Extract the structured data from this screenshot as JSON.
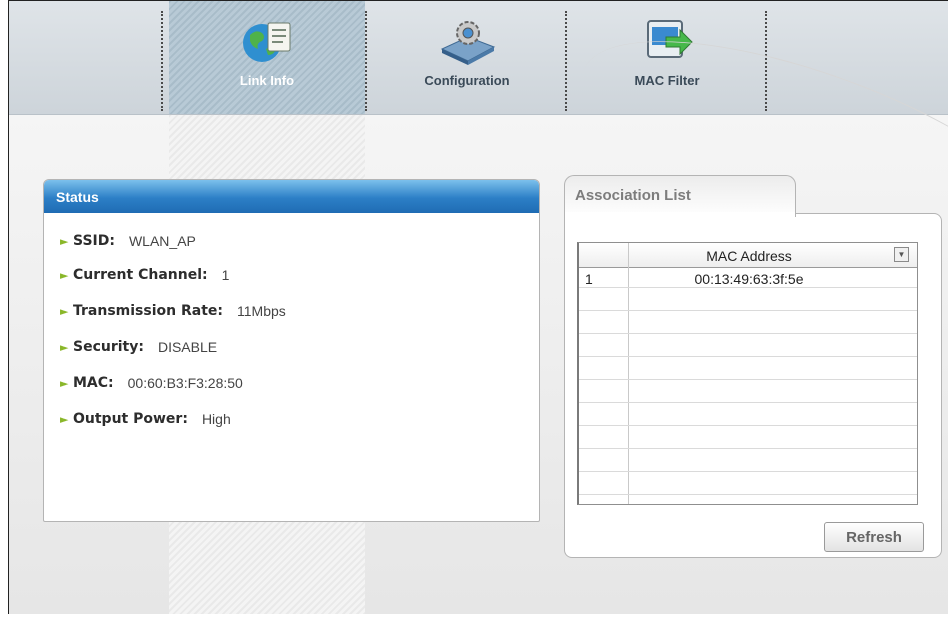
{
  "nav": {
    "tabs": [
      {
        "label": "Link Info",
        "icon": "globe-document-icon",
        "active": true
      },
      {
        "label": "Configuration",
        "icon": "gear-device-icon",
        "active": false
      },
      {
        "label": "MAC Filter",
        "icon": "filter-arrow-icon",
        "active": false
      }
    ]
  },
  "status": {
    "title": "Status",
    "rows": [
      {
        "label": "SSID:",
        "value": "WLAN_AP"
      },
      {
        "label": "Current Channel:",
        "value": "1"
      },
      {
        "label": "Transmission Rate:",
        "value": "11Mbps"
      },
      {
        "label": "Security:",
        "value": "DISABLE"
      },
      {
        "label": "MAC:",
        "value": "00:60:B3:F3:28:50"
      },
      {
        "label": "Output Power:",
        "value": "High"
      }
    ]
  },
  "association": {
    "title": "Association List",
    "columns": [
      "",
      "MAC Address"
    ],
    "rows": [
      {
        "index": "1",
        "mac": "00:13:49:63:3f:5e"
      }
    ],
    "refresh_label": "Refresh"
  },
  "colors": {
    "status_header": "#2c7fc6",
    "bullet": "#8ab72a",
    "active_tab": "#b0c4d0"
  }
}
